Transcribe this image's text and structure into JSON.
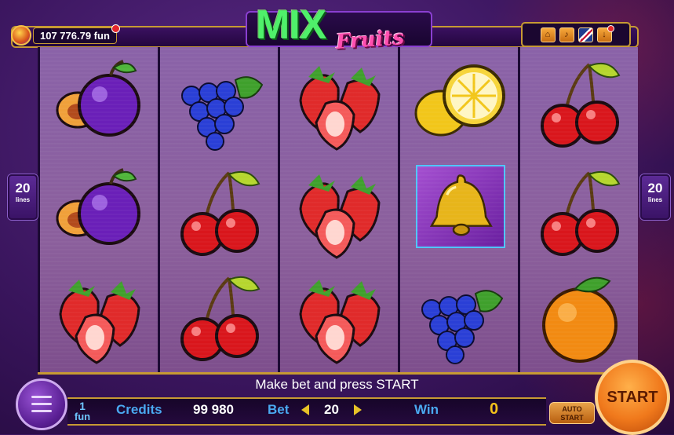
{
  "header": {
    "balance": "107 776.79 fun",
    "logo_main": "MIX",
    "logo_sub": "Fruits",
    "controls": [
      {
        "icon": "home-icon"
      },
      {
        "icon": "sound-icon"
      },
      {
        "icon": "language-flag-uk-icon"
      },
      {
        "icon": "download-icon"
      }
    ]
  },
  "side_lines": {
    "count": "20",
    "label": "lines"
  },
  "reels": [
    [
      "plum",
      "plum",
      "strawberry"
    ],
    [
      "grapes",
      "cherry",
      "cherry"
    ],
    [
      "strawberry",
      "strawberry",
      "strawberry"
    ],
    [
      "lemon",
      "bell",
      "grapes"
    ],
    [
      "cherry",
      "cherry",
      "orange"
    ]
  ],
  "highlighted_symbol": "bell",
  "message": "Make bet and press START",
  "footer": {
    "denomination_value": "1",
    "denomination_unit": "fun",
    "credits_label": "Credits",
    "credits_value": "99 980",
    "bet_label": "Bet",
    "bet_value": "20",
    "win_label": "Win",
    "win_value": "0",
    "auto_start_label_1": "AUTO",
    "auto_start_label_2": "START",
    "start_label": "START"
  },
  "colors": {
    "accent_gold": "#c79a33",
    "label_blue": "#4aa9f0",
    "win_yellow": "#f4c21b",
    "start_orange": "#f0791c"
  }
}
